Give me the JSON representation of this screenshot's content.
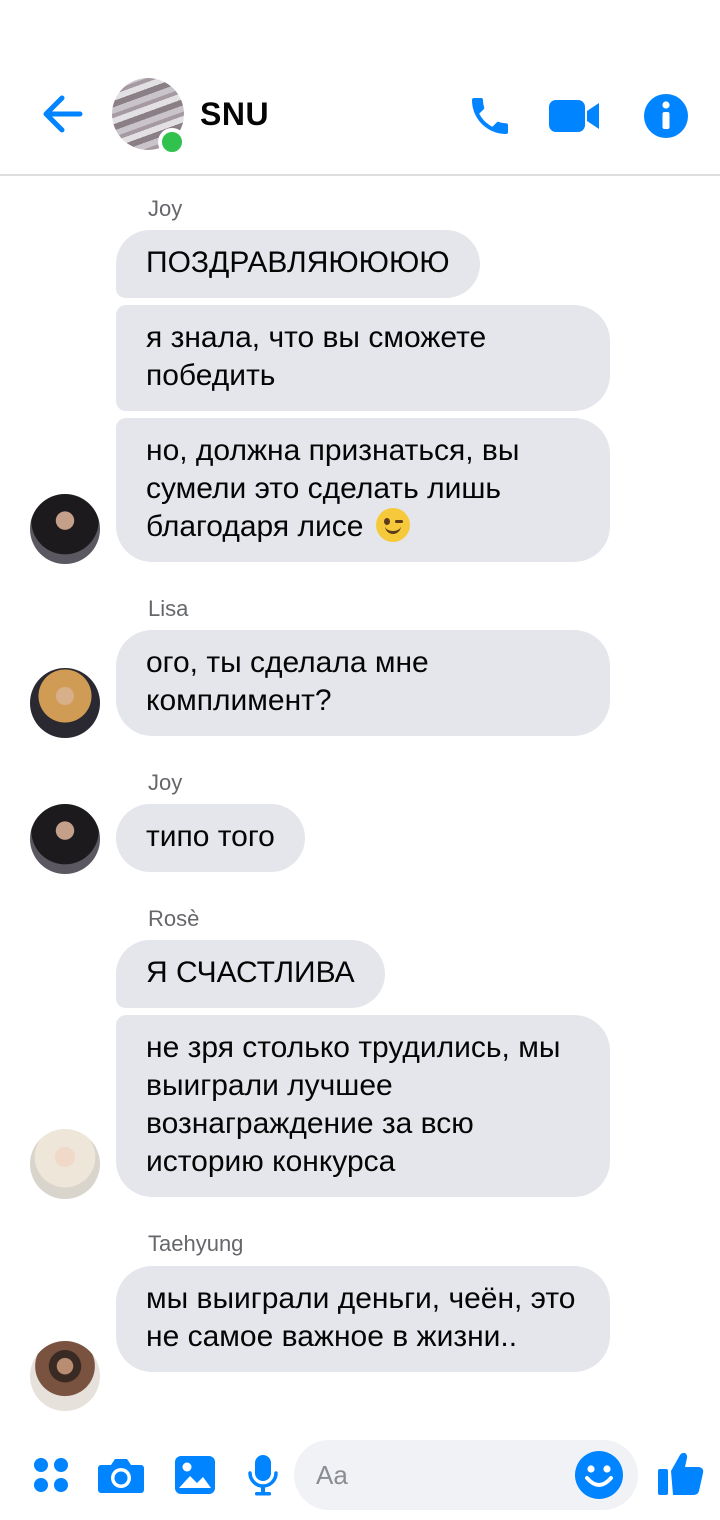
{
  "header": {
    "title": "SNU",
    "online": true
  },
  "colors": {
    "accent": "#0084ff",
    "bubble": "#e4e6eb",
    "online": "#31c24d",
    "sender_name": "#65676b"
  },
  "icons": {
    "back": "arrow-left-icon",
    "call": "phone-icon",
    "video": "video-camera-icon",
    "info": "info-icon",
    "more": "four-dots-icon",
    "camera": "camera-icon",
    "gallery": "image-icon",
    "voice": "microphone-icon",
    "emoji": "smiley-icon",
    "like": "thumbs-up-icon"
  },
  "messages": [
    {
      "sender": "Joy",
      "texts": [
        "ПОЗДРАВЛЯЮЮЮЮ",
        "я знала, что вы сможете победить",
        "но, должна признаться, вы сумели это сделать лишь благодаря лисе"
      ],
      "emoji": "winking-face"
    },
    {
      "sender": "Lisa",
      "texts": [
        "ого, ты сделала мне комплимент?"
      ]
    },
    {
      "sender": "Joy",
      "texts": [
        "типо того"
      ]
    },
    {
      "sender": "Rosè",
      "texts": [
        "Я СЧАСТЛИВА",
        "не зря столько трудились, мы выиграли лучшее вознаграждение за всю историю конкурса"
      ]
    },
    {
      "sender": "Taehyung",
      "texts": [
        "мы выиграли деньги, чеён, это не самое важное в жизни.."
      ]
    }
  ],
  "composer": {
    "placeholder": "Aa",
    "value": ""
  }
}
